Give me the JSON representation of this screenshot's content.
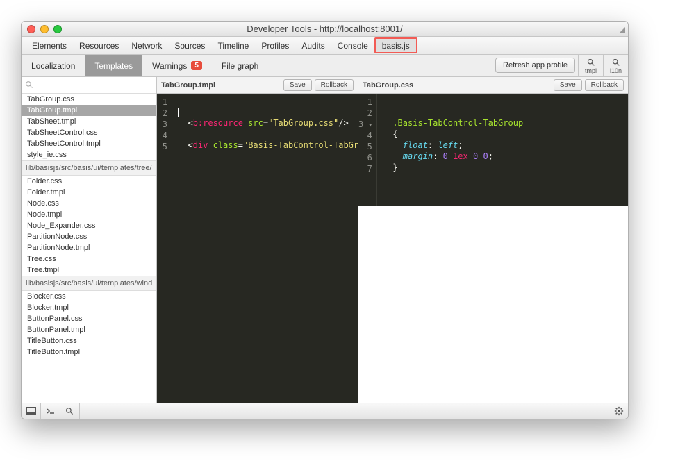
{
  "window_title": "Developer Tools - http://localhost:8001/",
  "devtools_tabs": [
    "Elements",
    "Resources",
    "Network",
    "Sources",
    "Timeline",
    "Profiles",
    "Audits",
    "Console",
    "basis.js"
  ],
  "devtools_tabs_active": 8,
  "subtabs": {
    "localization": "Localization",
    "templates": "Templates",
    "warnings": "Warnings",
    "warnings_count": "5",
    "filegraph": "File graph"
  },
  "toolbar": {
    "refresh": "Refresh app profile",
    "tmpl": "tmpl",
    "l10n": "l10n"
  },
  "sidebar": {
    "search_placeholder": "",
    "groups": [
      {
        "path": "",
        "files": [
          "TabGroup.css",
          "TabGroup.tmpl",
          "TabSheet.tmpl",
          "TabSheetControl.css",
          "TabSheetControl.tmpl",
          "style_ie.css"
        ],
        "selected": 1
      },
      {
        "path": "lib/basisjs/src/basis/ui/templates/tree/",
        "files": [
          "Folder.css",
          "Folder.tmpl",
          "Node.css",
          "Node.tmpl",
          "Node_Expander.css",
          "PartitionNode.css",
          "PartitionNode.tmpl",
          "Tree.css",
          "Tree.tmpl"
        ]
      },
      {
        "path": "lib/basisjs/src/basis/ui/templates/wind",
        "files": [
          "Blocker.css",
          "Blocker.tmpl",
          "ButtonPanel.css",
          "ButtonPanel.tmpl",
          "TitleButton.css",
          "TitleButton.tmpl"
        ]
      }
    ]
  },
  "editor_left": {
    "title": "TabGroup.tmpl",
    "save": "Save",
    "rollback": "Rollback",
    "lines": 5,
    "code": {
      "l1_open": "<",
      "l1_tag": "b:resource",
      "l1_attr": "src",
      "l1_str": "\"TabGroup.css\"",
      "l1_close": "/>",
      "l3_open": "<",
      "l3_tag": "div",
      "l3_attr": "class",
      "l3_str": "\"Basis-TabControl-TabGroup\""
    }
  },
  "editor_right": {
    "title": "TabGroup.css",
    "save": "Save",
    "rollback": "Rollback",
    "lines": 7,
    "code": {
      "selector": ".Basis-TabControl-TabGroup",
      "prop1": "float",
      "val1": "left",
      "prop2": "margin",
      "val2_a": "0",
      "val2_b": "1ex",
      "val2_c": "0",
      "val2_d": "0"
    }
  }
}
